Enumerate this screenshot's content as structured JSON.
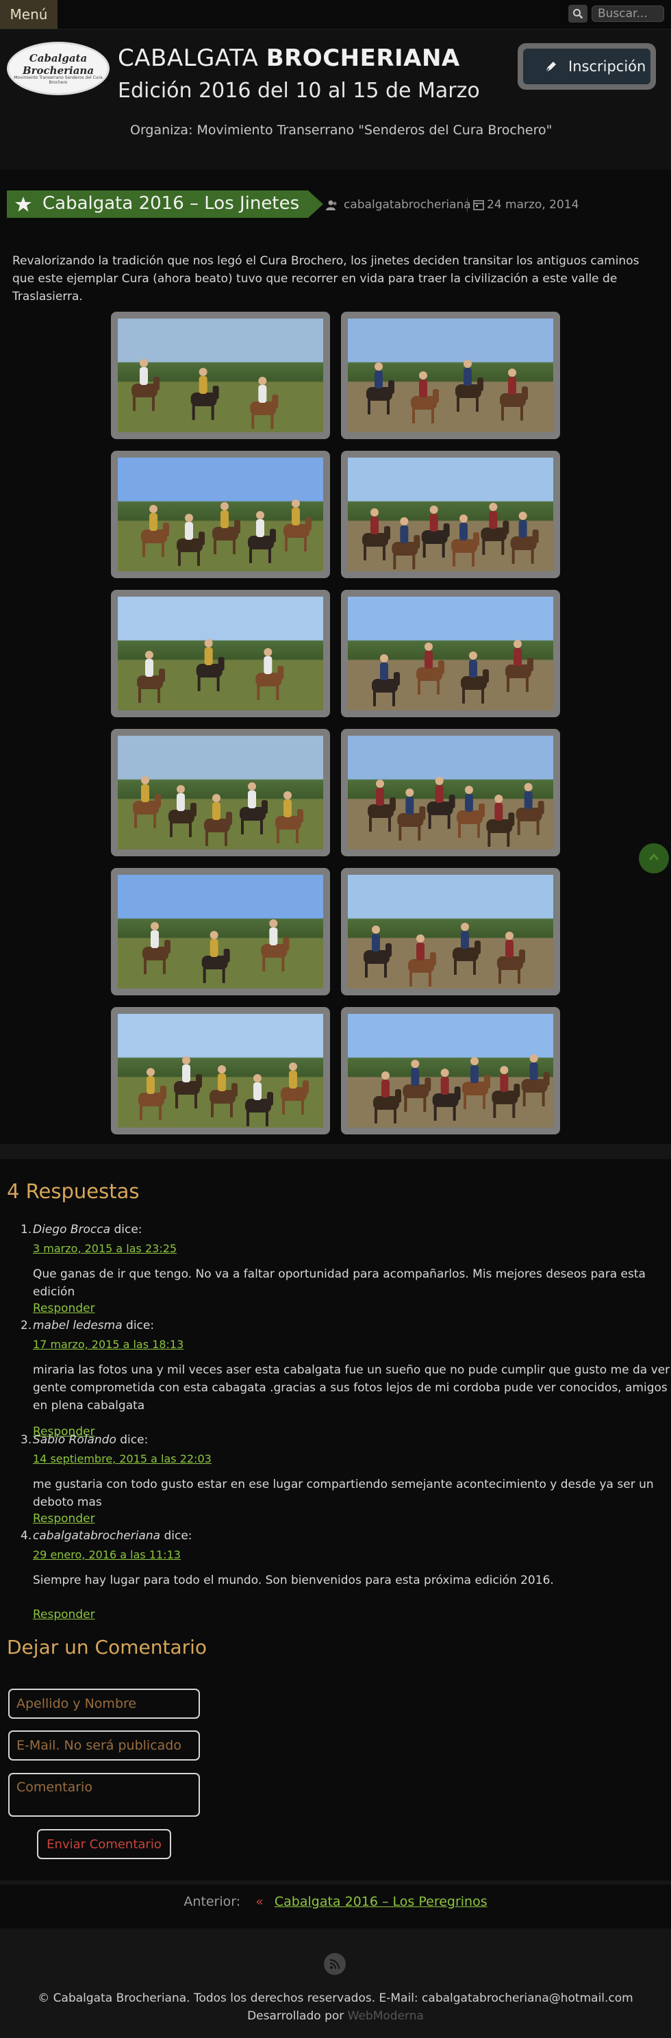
{
  "topbar": {
    "menu_label": "Menú",
    "search_placeholder": "Buscar..."
  },
  "header": {
    "logo_text": "Cabalgata Brocheriana",
    "logo_subtext": "Movimiento Transerrano Senderos del Cura Brochero",
    "title_regular": "CABALGATA",
    "title_bold": "BROCHERIANA",
    "subtitle": "Edición 2016 del 10 al 15 de Marzo",
    "organizer": "Organiza: Movimiento Transerrano \"Senderos del Cura Brochero\"",
    "signup_button": "Inscripción"
  },
  "post": {
    "title": "Cabalgata 2016 – Los Jinetes",
    "author": "cabalgatabrocheriana",
    "date": "24 marzo, 2014",
    "intro": "Revalorizando la tradición que nos legó el Cura Brochero, los jinetes deciden transitar los antiguos caminos que este ejemplar Cura (ahora beato) tuvo que recorrer en vida para traer la civilización a este valle de Traslasierra.",
    "photo_count": 12
  },
  "comments": {
    "title": "4 Respuestas",
    "says": "dice:",
    "reply_label": "Responder",
    "items": [
      {
        "num": "1.",
        "author": "Diego Brocca",
        "date": "3 marzo, 2015 a las 23:25",
        "text": "Que ganas de ir que tengo. No va a faltar oportunidad para acompañarlos. Mis mejores deseos para esta edición"
      },
      {
        "num": "2.",
        "author": "mabel ledesma",
        "date": "17 marzo, 2015 a las 18:13",
        "text": "miraria las fotos una y mil veces aser esta cabalgata fue un sueño que no pude cumplir que gusto me da ver gente comprometida con esta cabagata .gracias a sus fotos lejos de mi cordoba pude ver conocidos, amigos en plena cabalgata"
      },
      {
        "num": "3.",
        "author": "Sabio Rolando",
        "date": "14 septiembre, 2015 a las 22:03",
        "text": "me gustaria con todo gusto estar en ese lugar compartiendo semejante acontecimiento y desde ya ser un deboto mas"
      },
      {
        "num": "4.",
        "author": "cabalgatabrocheriana",
        "date": "29 enero, 2016 a las 11:13",
        "text": "Siempre hay lugar para todo el mundo. Son bienvenidos para esta próxima edición 2016."
      }
    ]
  },
  "comment_form": {
    "title": "Dejar un Comentario",
    "name_placeholder": "Apellido y Nombre",
    "email_placeholder": "E-Mail. No será publicado",
    "comment_placeholder": "Comentario",
    "submit_label": "Enviar Comentario"
  },
  "navigation": {
    "previous_label": "Anterior:",
    "previous_arrow": "«",
    "previous_link": "Cabalgata 2016 – Los Peregrinos"
  },
  "footer": {
    "copyright": "© Cabalgata Brocheriana. Todos los derechos reservados. E-Mail: cabalgatabrocheriana@hotmail.com",
    "developed_by": "Desarrollado por",
    "developer": "WebModerna"
  },
  "colors": {
    "accent_green": "#8dc63f",
    "ribbon_green": "#3b6b26",
    "heading_gold": "#d7a65a",
    "submit_red": "#c8443a"
  }
}
